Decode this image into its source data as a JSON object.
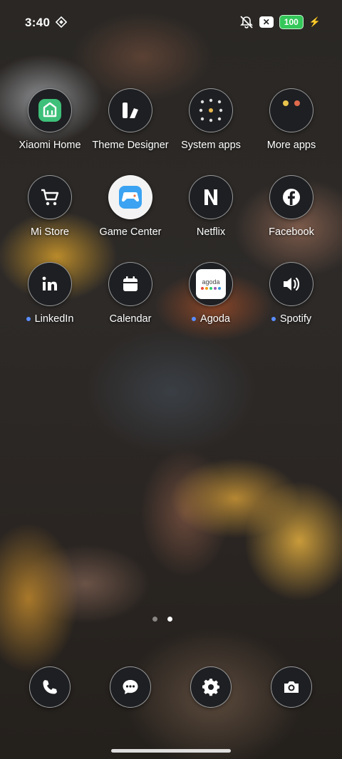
{
  "status": {
    "time": "3:40",
    "battery": "100"
  },
  "apps": [
    {
      "label": "Xiaomi Home",
      "icon": "xiaomi-home-icon",
      "dot": false
    },
    {
      "label": "Theme Designer",
      "icon": "theme-designer-icon",
      "dot": false
    },
    {
      "label": "System apps",
      "icon": "system-apps-folder-icon",
      "dot": false
    },
    {
      "label": "More apps",
      "icon": "more-apps-folder-icon",
      "dot": false
    },
    {
      "label": "Mi Store",
      "icon": "cart-icon",
      "dot": false
    },
    {
      "label": "Game Center",
      "icon": "gamepad-icon",
      "dot": false
    },
    {
      "label": "Netflix",
      "icon": "netflix-icon",
      "dot": false
    },
    {
      "label": "Facebook",
      "icon": "facebook-icon",
      "dot": false
    },
    {
      "label": "LinkedIn",
      "icon": "linkedin-icon",
      "dot": true
    },
    {
      "label": "Calendar",
      "icon": "calendar-icon",
      "dot": false
    },
    {
      "label": "Agoda",
      "icon": "agoda-icon",
      "dot": true,
      "icon_text": "agoda"
    },
    {
      "label": "Spotify",
      "icon": "speaker-icon",
      "dot": true
    }
  ],
  "dock": [
    {
      "name": "phone-icon"
    },
    {
      "name": "messages-icon"
    },
    {
      "name": "settings-gear-icon"
    },
    {
      "name": "camera-icon"
    }
  ],
  "pager": {
    "pages": 2,
    "active": 2
  },
  "colors": {
    "accent_dot": "#5a8dff",
    "battery": "#34c759"
  }
}
